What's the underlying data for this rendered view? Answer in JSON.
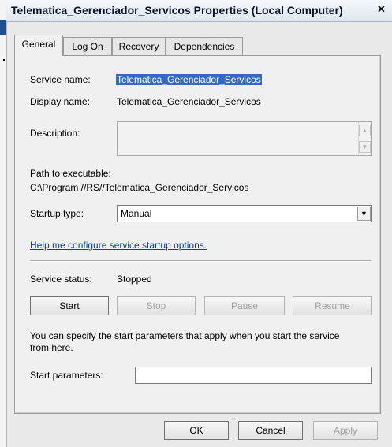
{
  "window": {
    "title": "Telematica_Gerenciador_Servicos Properties (Local Computer)",
    "close_symbol": "✕"
  },
  "tabs": [
    {
      "label": "General",
      "active": true
    },
    {
      "label": "Log On",
      "active": false
    },
    {
      "label": "Recovery",
      "active": false
    },
    {
      "label": "Dependencies",
      "active": false
    }
  ],
  "general": {
    "service_name_label": "Service name:",
    "service_name_value": "Telematica_Gerenciador_Servicos",
    "display_name_label": "Display name:",
    "display_name_value": "Telematica_Gerenciador_Servicos",
    "description_label": "Description:",
    "description_value": "",
    "path_label": "Path to executable:",
    "path_value": "C:\\Program //RS//Telematica_Gerenciador_Servicos",
    "startup_type_label": "Startup type:",
    "startup_type_value": "Manual",
    "help_link": "Help me configure service startup options.",
    "service_status_label": "Service status:",
    "service_status_value": "Stopped",
    "buttons": {
      "start": "Start",
      "stop": "Stop",
      "pause": "Pause",
      "resume": "Resume"
    },
    "start_params_note": "You can specify the start parameters that apply when you start the service",
    "start_params_note_2": "from here.",
    "start_params_label": "Start parameters:",
    "start_params_value": ""
  },
  "footer": {
    "ok": "OK",
    "cancel": "Cancel",
    "apply": "Apply"
  },
  "icons": {
    "scroll_up": "▲",
    "scroll_down": "▼",
    "dropdown": "▼"
  },
  "colors": {
    "selection": "#3169c6",
    "link": "#0645ad",
    "dialog_bg": "#f0f0f0"
  }
}
